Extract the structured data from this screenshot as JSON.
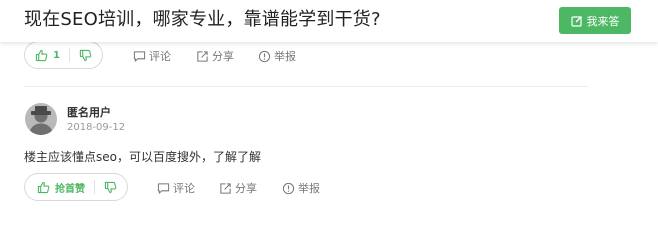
{
  "header": {
    "title": "现在SEO培训，哪家专业，靠谱能学到干货?",
    "answer_button": "我来答"
  },
  "answer1": {
    "upvote_count": "1",
    "comment_label": "评论",
    "share_label": "分享",
    "report_label": "举报"
  },
  "answer2": {
    "username": "匿名用户",
    "date": "2018-09-12",
    "text": "楼主应该懂点seo，可以百度搜外，了解了解",
    "upvote_label": "抢首赞",
    "comment_label": "评论",
    "share_label": "分享",
    "report_label": "举报"
  },
  "colors": {
    "accent": "#4db864",
    "muted": "#777777",
    "border": "#d9d9d9"
  }
}
